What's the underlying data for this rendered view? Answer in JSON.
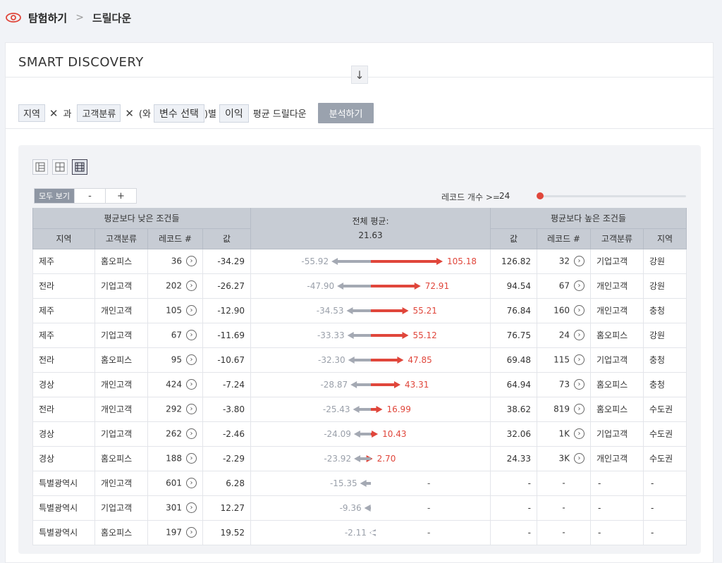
{
  "breadcrumb": {
    "root": "탐험하기",
    "current": "드릴다운"
  },
  "panel": {
    "title_bold": "SMART",
    "title_rest": " DISCOVERY"
  },
  "query": {
    "var1": "지역",
    "conj": "과",
    "var2": "고객분류",
    "open_text": "(와",
    "var3": "변수 선택",
    "close_text": ")별",
    "metric": "이익",
    "suffix": "평균 드릴다운",
    "analyze_button": "분석하기"
  },
  "controls": {
    "show_all": "모두 보기",
    "zoom_out": "-",
    "zoom_in": "+",
    "record_label": "레코드 개수 >=",
    "record_value": "24",
    "record_threshold_level": 0.0
  },
  "table": {
    "left_group": "평균보다 낮은 조건들",
    "right_group": "평균보다 높은 조건들",
    "center_label": "전체 평균:",
    "center_value": "21.63",
    "left_headers": [
      "지역",
      "고객분류",
      "레코드 #",
      "값"
    ],
    "right_headers": [
      "값",
      "레코드 #",
      "고객분류",
      "지역"
    ],
    "colors": {
      "low": "#a4a9b3",
      "high": "#e0463b"
    },
    "rows": [
      {
        "l_region": "제주",
        "l_seg": "홈오피스",
        "l_rec": "36",
        "l_val": "-34.29",
        "low": "-55.92",
        "high": "105.18",
        "r_val": "126.82",
        "r_rec": "32",
        "r_seg": "기업고객",
        "r_region": "강원"
      },
      {
        "l_region": "전라",
        "l_seg": "기업고객",
        "l_rec": "202",
        "l_val": "-26.27",
        "low": "-47.90",
        "high": "72.91",
        "r_val": "94.54",
        "r_rec": "67",
        "r_seg": "개인고객",
        "r_region": "강원"
      },
      {
        "l_region": "제주",
        "l_seg": "개인고객",
        "l_rec": "105",
        "l_val": "-12.90",
        "low": "-34.53",
        "high": "55.21",
        "r_val": "76.84",
        "r_rec": "160",
        "r_seg": "개인고객",
        "r_region": "충청"
      },
      {
        "l_region": "제주",
        "l_seg": "기업고객",
        "l_rec": "67",
        "l_val": "-11.69",
        "low": "-33.33",
        "high": "55.12",
        "r_val": "76.75",
        "r_rec": "24",
        "r_seg": "홈오피스",
        "r_region": "강원"
      },
      {
        "l_region": "전라",
        "l_seg": "홈오피스",
        "l_rec": "95",
        "l_val": "-10.67",
        "low": "-32.30",
        "high": "47.85",
        "r_val": "69.48",
        "r_rec": "115",
        "r_seg": "기업고객",
        "r_region": "충청"
      },
      {
        "l_region": "경상",
        "l_seg": "개인고객",
        "l_rec": "424",
        "l_val": "-7.24",
        "low": "-28.87",
        "high": "43.31",
        "r_val": "64.94",
        "r_rec": "73",
        "r_seg": "홈오피스",
        "r_region": "충청"
      },
      {
        "l_region": "전라",
        "l_seg": "개인고객",
        "l_rec": "292",
        "l_val": "-3.80",
        "low": "-25.43",
        "high": "16.99",
        "r_val": "38.62",
        "r_rec": "819",
        "r_seg": "홈오피스",
        "r_region": "수도권"
      },
      {
        "l_region": "경상",
        "l_seg": "기업고객",
        "l_rec": "262",
        "l_val": "-2.46",
        "low": "-24.09",
        "high": "10.43",
        "r_val": "32.06",
        "r_rec": "1K",
        "r_seg": "기업고객",
        "r_region": "수도권"
      },
      {
        "l_region": "경상",
        "l_seg": "홈오피스",
        "l_rec": "188",
        "l_val": "-2.29",
        "low": "-23.92",
        "high": "2.70",
        "r_val": "24.33",
        "r_rec": "3K",
        "r_seg": "개인고객",
        "r_region": "수도권"
      },
      {
        "l_region": "특별광역시",
        "l_seg": "개인고객",
        "l_rec": "601",
        "l_val": "6.28",
        "low": "-15.35",
        "high": "-",
        "r_val": "-",
        "r_rec": "-",
        "r_seg": "-",
        "r_region": "-"
      },
      {
        "l_region": "특별광역시",
        "l_seg": "기업고객",
        "l_rec": "301",
        "l_val": "12.27",
        "low": "-9.36",
        "high": "-",
        "r_val": "-",
        "r_rec": "-",
        "r_seg": "-",
        "r_region": "-"
      },
      {
        "l_region": "특별광역시",
        "l_seg": "홈오피스",
        "l_rec": "197",
        "l_val": "19.52",
        "low": "-2.11",
        "high": "-",
        "r_val": "-",
        "r_rec": "-",
        "r_seg": "-",
        "r_region": "-"
      }
    ]
  }
}
